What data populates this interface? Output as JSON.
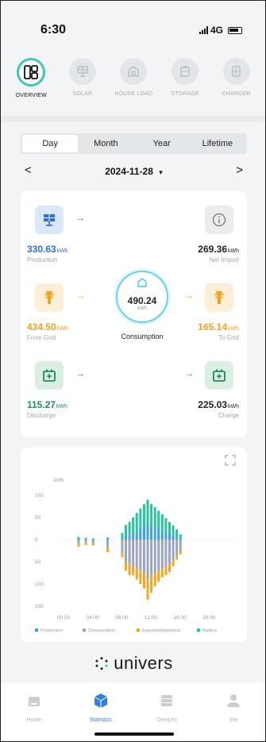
{
  "status_bar": {
    "time": "6:30",
    "network": "4G"
  },
  "top_nav": [
    {
      "label": "OVERVIEW",
      "icon": "overview-icon",
      "active": true
    },
    {
      "label": "SOLAR",
      "icon": "solar-icon",
      "active": false
    },
    {
      "label": "HOUSE LOAD",
      "icon": "house-load-icon",
      "active": false
    },
    {
      "label": "STORAGE",
      "icon": "storage-icon",
      "active": false
    },
    {
      "label": "CHARGER",
      "icon": "charger-icon",
      "active": false
    }
  ],
  "period_tabs": [
    {
      "label": "Day",
      "active": true
    },
    {
      "label": "Month",
      "active": false
    },
    {
      "label": "Year",
      "active": false
    },
    {
      "label": "Lifetime",
      "active": false
    }
  ],
  "date_selector": {
    "prev": "<",
    "date": "2024-11-28",
    "caret": "▾",
    "next": ">"
  },
  "energy_flow": {
    "unit": "kWh",
    "production": {
      "value": "330.63",
      "label": "Production"
    },
    "net_import": {
      "value": "269.36",
      "label": "Net Import"
    },
    "from_grid": {
      "value": "434.50",
      "label": "From Grid"
    },
    "to_grid": {
      "value": "165.14",
      "label": "To Grid"
    },
    "discharge": {
      "value": "115.27",
      "label": "Discharge"
    },
    "charge": {
      "value": "225.03",
      "label": "Charge"
    },
    "consumption": {
      "value": "490.24",
      "unit": "kWh",
      "label": "Consumption"
    },
    "arrow": "→"
  },
  "chart_data": {
    "type": "bar",
    "stacked": true,
    "ylabel": "kWh",
    "y_tick_labels": [
      "100",
      "50",
      "0",
      "50",
      "100",
      "150"
    ],
    "x_tick_labels": [
      "00:00",
      "04:00",
      "08:00",
      "12:00",
      "16:00",
      "20:00"
    ],
    "x_range": [
      0,
      24
    ],
    "y_range": [
      -150,
      100
    ],
    "legend_position": "bottom",
    "series": [
      {
        "name": "Production",
        "color": "#3aa0e8"
      },
      {
        "name": "Consumption",
        "color": "#9ba5c0"
      },
      {
        "name": "Exported/Imported",
        "color": "#f5a623"
      },
      {
        "name": "Battery",
        "color": "#27c6a0"
      }
    ],
    "bars": [
      {
        "x": 2.5,
        "production": 0,
        "consumption": -8,
        "exported_imported": 8,
        "battery": 6
      },
      {
        "x": 3.5,
        "production": 0,
        "consumption": -6,
        "exported_imported": 6,
        "battery": 4
      },
      {
        "x": 4.5,
        "production": 0,
        "consumption": -8,
        "exported_imported": 5,
        "battery": 3
      },
      {
        "x": 6.5,
        "production": 0,
        "consumption": -18,
        "exported_imported": 10,
        "battery": 5
      },
      {
        "x": 8.5,
        "production": 0,
        "consumption": -30,
        "exported_imported": 10,
        "battery": 15
      },
      {
        "x": 9.0,
        "production": 8,
        "consumption": -50,
        "exported_imported": 20,
        "battery": 25
      },
      {
        "x": 9.5,
        "production": 10,
        "consumption": -55,
        "exported_imported": 25,
        "battery": 30
      },
      {
        "x": 10.0,
        "production": 15,
        "consumption": -60,
        "exported_imported": 20,
        "battery": 35
      },
      {
        "x": 10.5,
        "production": 20,
        "consumption": -65,
        "exported_imported": 25,
        "battery": 40
      },
      {
        "x": 11.0,
        "production": 25,
        "consumption": -70,
        "exported_imported": 30,
        "battery": 45
      },
      {
        "x": 11.5,
        "production": 30,
        "consumption": -75,
        "exported_imported": 35,
        "battery": 50
      },
      {
        "x": 12.0,
        "production": 35,
        "consumption": -90,
        "exported_imported": 45,
        "battery": 55
      },
      {
        "x": 12.5,
        "production": 30,
        "consumption": -80,
        "exported_imported": 40,
        "battery": 50
      },
      {
        "x": 13.0,
        "production": 28,
        "consumption": -75,
        "exported_imported": 30,
        "battery": 45
      },
      {
        "x": 13.5,
        "production": 25,
        "consumption": -70,
        "exported_imported": 25,
        "battery": 40
      },
      {
        "x": 14.0,
        "production": 22,
        "consumption": -65,
        "exported_imported": 20,
        "battery": 35
      },
      {
        "x": 14.5,
        "production": 18,
        "consumption": -60,
        "exported_imported": 20,
        "battery": 30
      },
      {
        "x": 15.0,
        "production": 15,
        "consumption": -55,
        "exported_imported": 18,
        "battery": 25
      },
      {
        "x": 15.5,
        "production": 10,
        "consumption": -45,
        "exported_imported": 15,
        "battery": 22
      },
      {
        "x": 16.0,
        "production": 5,
        "consumption": -35,
        "exported_imported": 10,
        "battery": 18
      },
      {
        "x": 16.5,
        "production": 0,
        "consumption": -25,
        "exported_imported": 8,
        "battery": 12
      }
    ]
  },
  "brand": {
    "name": "univers"
  },
  "tab_bar": [
    {
      "label": "Home",
      "icon": "home-icon",
      "active": false
    },
    {
      "label": "Statistics",
      "icon": "statistics-icon",
      "active": true
    },
    {
      "label": "Devices",
      "icon": "devices-icon",
      "active": false
    },
    {
      "label": "Me",
      "icon": "me-icon",
      "active": false
    }
  ]
}
